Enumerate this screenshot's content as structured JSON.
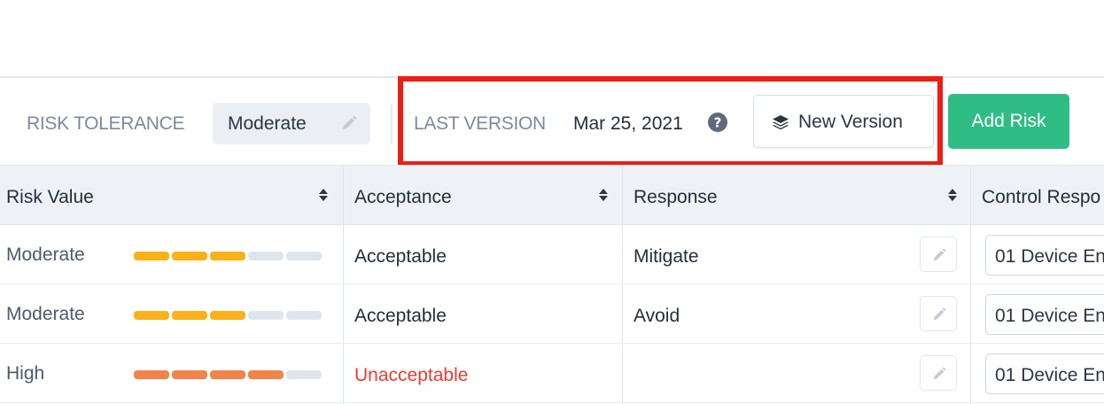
{
  "toolbar": {
    "risk_tolerance_label": "RISK TOLERANCE",
    "risk_tolerance_value": "Moderate",
    "last_version_label": "LAST VERSION",
    "last_version_date": "Mar 25, 2021",
    "new_version_label": "New Version",
    "add_risk_label": "Add Risk"
  },
  "table": {
    "columns": [
      {
        "label": "Risk Value"
      },
      {
        "label": "Acceptance"
      },
      {
        "label": "Response"
      },
      {
        "label": "Control Respo"
      }
    ],
    "rows": [
      {
        "risk_value": "Moderate",
        "level": 3,
        "acceptance": "Acceptable",
        "acceptance_status": "ok",
        "response": "Mitigate",
        "control": "01 Device En"
      },
      {
        "risk_value": "Moderate",
        "level": 3,
        "acceptance": "Acceptable",
        "acceptance_status": "ok",
        "response": "Avoid",
        "control": "01 Device En"
      },
      {
        "risk_value": "High",
        "level": 4,
        "acceptance": "Unacceptable",
        "acceptance_status": "bad",
        "response": "",
        "control": "01 Device En"
      }
    ],
    "max_level": 5
  },
  "colors": {
    "moderate_bar": "#fbb117",
    "high_bar": "#f0844a",
    "empty_bar": "#dfe5ec",
    "unacceptable_text": "#ee3a2f",
    "add_risk_bg": "#2fbd85",
    "annotation_box": "#ee1d12"
  },
  "icons": {
    "tolerance_edit": "pencil-icon",
    "help": "question-circle-icon",
    "new_version": "layers-icon",
    "sort": "sort-icon",
    "row_edit": "pencil-icon"
  }
}
